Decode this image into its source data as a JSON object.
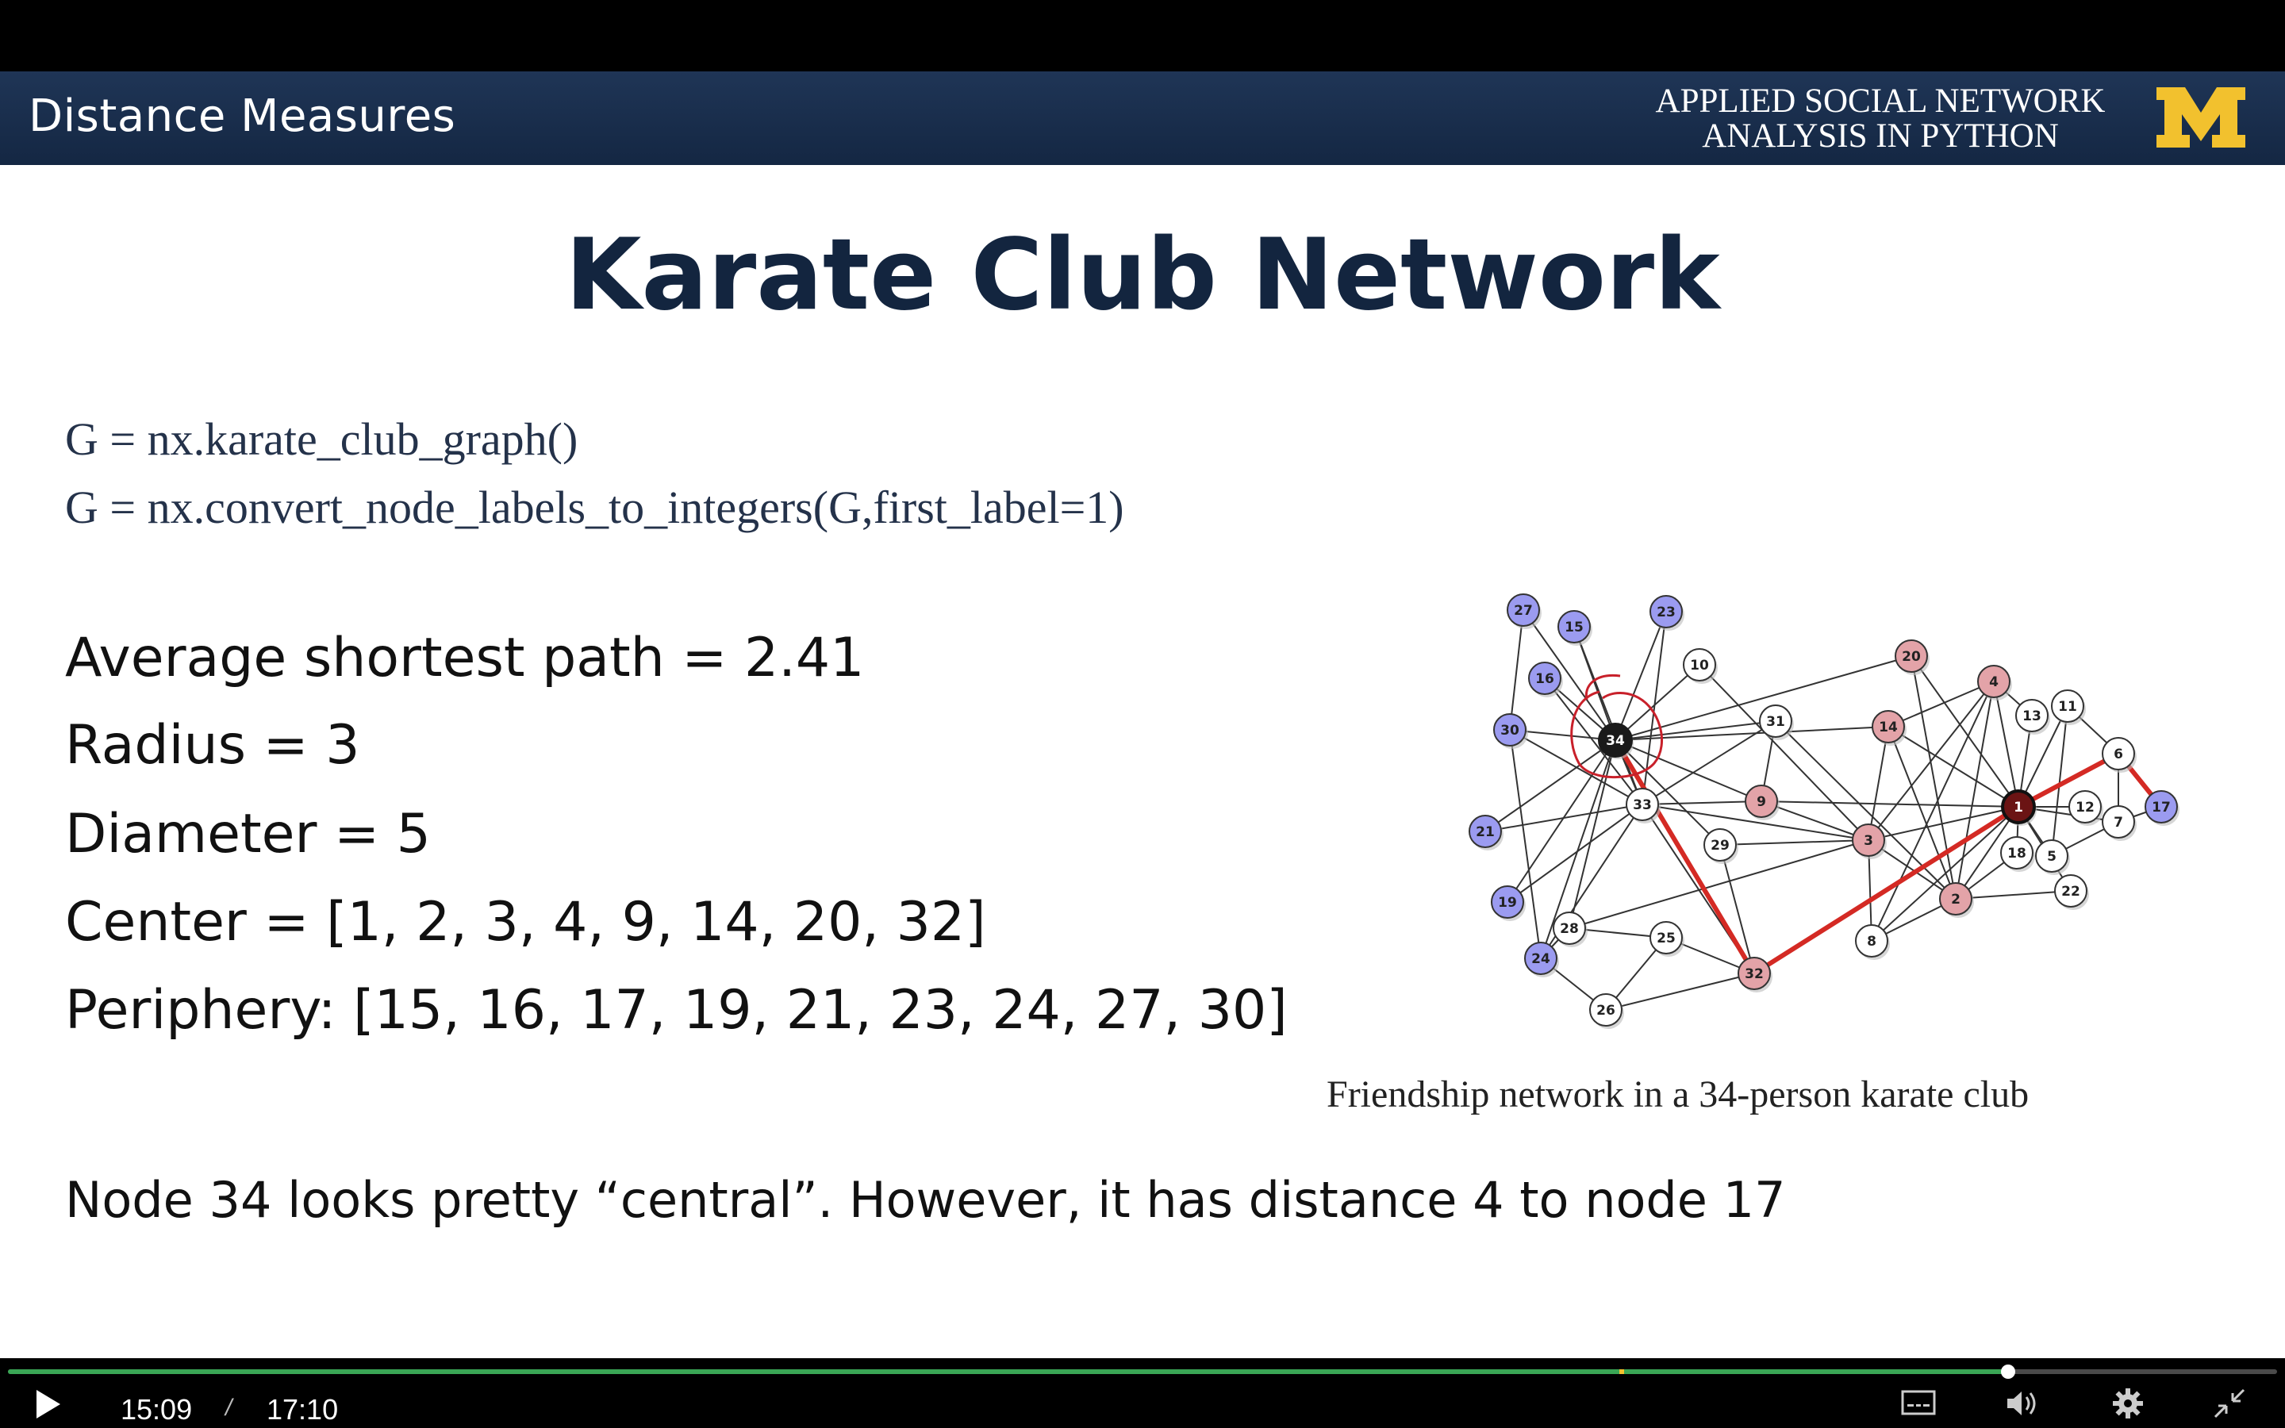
{
  "header": {
    "title": "Distance Measures",
    "course_line1": "APPLIED SOCIAL NETWORK",
    "course_line2": "ANALYSIS IN PYTHON",
    "logo_letter": "M",
    "colors": {
      "bar": "#1a2e4d",
      "logo": "#f2c12e"
    }
  },
  "slide": {
    "title": "Karate Club Network",
    "code_line1": "G = nx.karate_club_graph()",
    "code_line2": "G = nx.convert_node_labels_to_integers(G,first_label=1)",
    "stats": {
      "avg": "Average shortest path = 2.41",
      "radius": "Radius = 3",
      "diameter": "Diameter = 5",
      "center": "Center = [1, 2, 3, 4, 9, 14, 20, 32]",
      "periphery": "Periphery: [15, 16, 17, 19, 21, 23, 24, 27, 30]"
    },
    "caption": "Friendship network in a 34-person karate club",
    "note": "Node 34 looks pretty “central”.  However, it has distance 4 to node 17"
  },
  "network": {
    "colors": {
      "periphery": "#9b9bf0",
      "center": "#e3a3a8",
      "plain": "#ffffff",
      "path": "#d42a24",
      "edge": "#333333"
    },
    "periphery_nodes": [
      "15",
      "16",
      "17",
      "19",
      "21",
      "23",
      "24",
      "27",
      "30"
    ],
    "center_nodes": [
      "1",
      "2",
      "3",
      "4",
      "9",
      "14",
      "20",
      "32"
    ],
    "highlight_path": [
      "34",
      "32",
      "1",
      "6",
      "17"
    ],
    "edges": [
      [
        "2",
        "1"
      ],
      [
        "3",
        "1"
      ],
      [
        "3",
        "2"
      ],
      [
        "4",
        "1"
      ],
      [
        "4",
        "2"
      ],
      [
        "4",
        "3"
      ],
      [
        "5",
        "1"
      ],
      [
        "6",
        "1"
      ],
      [
        "7",
        "1"
      ],
      [
        "7",
        "5"
      ],
      [
        "7",
        "6"
      ],
      [
        "8",
        "1"
      ],
      [
        "8",
        "2"
      ],
      [
        "8",
        "3"
      ],
      [
        "8",
        "4"
      ],
      [
        "9",
        "1"
      ],
      [
        "9",
        "3"
      ],
      [
        "10",
        "3"
      ],
      [
        "11",
        "1"
      ],
      [
        "11",
        "5"
      ],
      [
        "11",
        "6"
      ],
      [
        "12",
        "1"
      ],
      [
        "13",
        "1"
      ],
      [
        "13",
        "4"
      ],
      [
        "14",
        "1"
      ],
      [
        "14",
        "2"
      ],
      [
        "14",
        "3"
      ],
      [
        "14",
        "4"
      ],
      [
        "17",
        "6"
      ],
      [
        "17",
        "7"
      ],
      [
        "18",
        "1"
      ],
      [
        "18",
        "2"
      ],
      [
        "20",
        "1"
      ],
      [
        "20",
        "2"
      ],
      [
        "22",
        "1"
      ],
      [
        "22",
        "2"
      ],
      [
        "26",
        "24"
      ],
      [
        "26",
        "25"
      ],
      [
        "28",
        "3"
      ],
      [
        "28",
        "24"
      ],
      [
        "28",
        "25"
      ],
      [
        "29",
        "3"
      ],
      [
        "30",
        "24"
      ],
      [
        "30",
        "27"
      ],
      [
        "31",
        "2"
      ],
      [
        "31",
        "9"
      ],
      [
        "32",
        "1"
      ],
      [
        "32",
        "25"
      ],
      [
        "32",
        "26"
      ],
      [
        "32",
        "29"
      ],
      [
        "33",
        "3"
      ],
      [
        "33",
        "9"
      ],
      [
        "33",
        "15"
      ],
      [
        "33",
        "16"
      ],
      [
        "33",
        "19"
      ],
      [
        "33",
        "21"
      ],
      [
        "33",
        "23"
      ],
      [
        "33",
        "24"
      ],
      [
        "33",
        "30"
      ],
      [
        "33",
        "31"
      ],
      [
        "33",
        "32"
      ],
      [
        "34",
        "9"
      ],
      [
        "34",
        "10"
      ],
      [
        "34",
        "14"
      ],
      [
        "34",
        "15"
      ],
      [
        "34",
        "16"
      ],
      [
        "34",
        "19"
      ],
      [
        "34",
        "20"
      ],
      [
        "34",
        "21"
      ],
      [
        "34",
        "23"
      ],
      [
        "34",
        "24"
      ],
      [
        "34",
        "27"
      ],
      [
        "34",
        "28"
      ],
      [
        "34",
        "29"
      ],
      [
        "34",
        "30"
      ],
      [
        "34",
        "31"
      ],
      [
        "34",
        "32"
      ],
      [
        "34",
        "33"
      ]
    ]
  },
  "player": {
    "current_time": "15:09",
    "separator": "/",
    "duration": "17:10",
    "progress": 0.8815,
    "buffered_marker": 0.71,
    "icons": [
      "play-icon",
      "captions-icon",
      "volume-icon",
      "settings-gear-icon",
      "exit-fullscreen-icon"
    ],
    "colors": {
      "progress": "#3aa655",
      "marker": "#f2c12e"
    }
  }
}
